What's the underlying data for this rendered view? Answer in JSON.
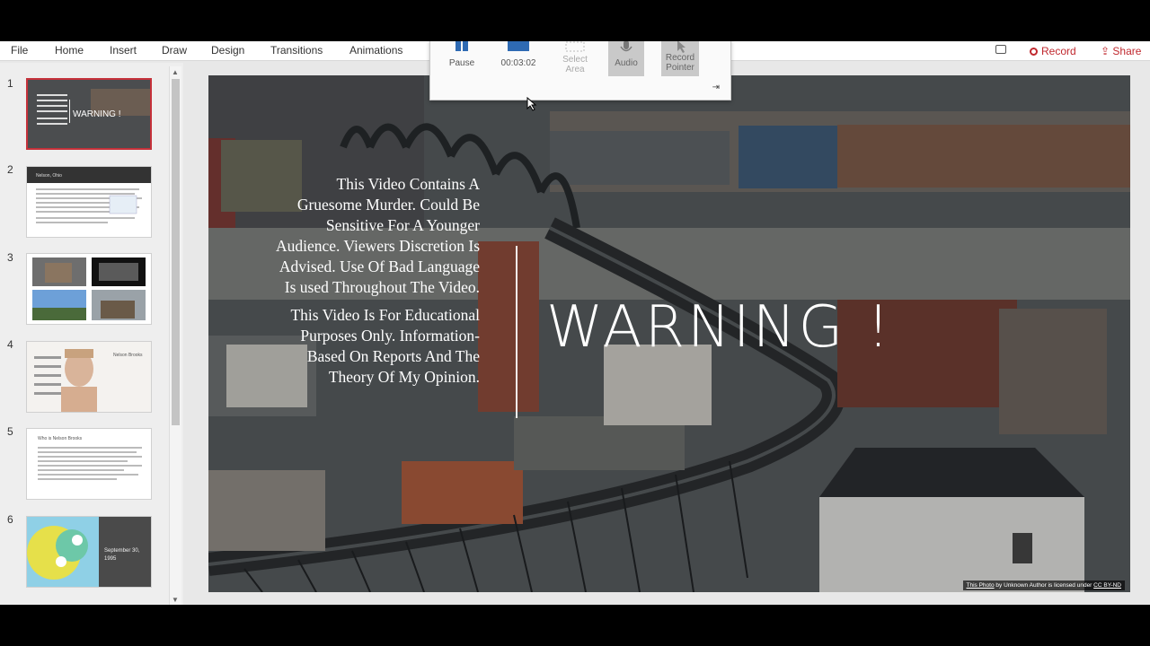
{
  "menu": {
    "items": [
      "File",
      "Home",
      "Insert",
      "Draw",
      "Design",
      "Transitions",
      "Animations"
    ],
    "record": "Record",
    "share": "Share"
  },
  "recording_toolbar": {
    "pause": "Pause",
    "timer": "00:03:02",
    "select_area": "Select Area",
    "audio": "Audio",
    "record_pointer": "Record Pointer"
  },
  "thumbnails": {
    "numbers": [
      "1",
      "2",
      "3",
      "4",
      "5",
      "6"
    ],
    "slide1_label": "WARNING !",
    "slide2_title": "Nelson, Ohio",
    "slide4_title": "Nelson Brooks",
    "slide5_title": "Who is Nelson Brooks",
    "slide6_text": "September 30, 1995"
  },
  "slide": {
    "warning_title": "WARNING !",
    "paragraph1": "This Video Contains A Gruesome Murder. Could Be Sensitive For A Younger Audience. Viewers Discretion Is Advised. Use Of Bad Language Is used Throughout The Video.",
    "paragraph2": "This Video Is For Educational Purposes Only. Information-Based On Reports And The Theory Of My Opinion.",
    "credit_link": "This Photo",
    "credit_middle": " by Unknown Author is licensed under ",
    "credit_license": "CC BY-ND"
  },
  "colors": {
    "accent": "#c5313a",
    "slide_text": "#ffffff"
  }
}
